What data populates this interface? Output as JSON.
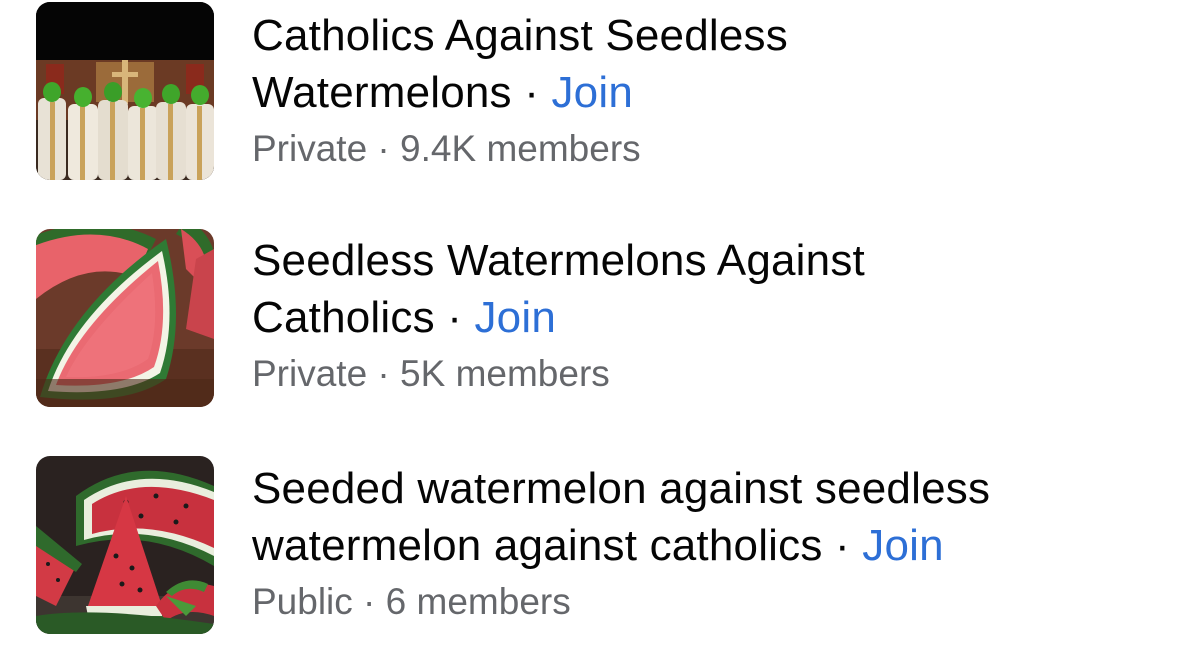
{
  "groups": [
    {
      "title_line1": "Catholics Against Seedless",
      "title_line2": "Watermelons",
      "separator": " · ",
      "join_label": "Join",
      "privacy": "Private",
      "meta_sep": " · ",
      "members": "9.4K members",
      "thumbnail": "priests-with-watermelon-heads"
    },
    {
      "title_line1": "Seedless Watermelons Against",
      "title_line2": "Catholics",
      "separator": " · ",
      "join_label": "Join",
      "privacy": "Private",
      "meta_sep": " · ",
      "members": "5K members",
      "thumbnail": "watermelon-slices"
    },
    {
      "title_line1": "Seeded watermelon against seedless",
      "title_line2": "watermelon against catholics",
      "separator": " · ",
      "join_label": "Join",
      "privacy": "Public",
      "meta_sep": " · ",
      "members": "6 members",
      "thumbnail": "seeded-watermelon-wedges"
    }
  ],
  "colors": {
    "title": "#050505",
    "join_link": "#2d6fd6",
    "meta": "#65676b"
  }
}
